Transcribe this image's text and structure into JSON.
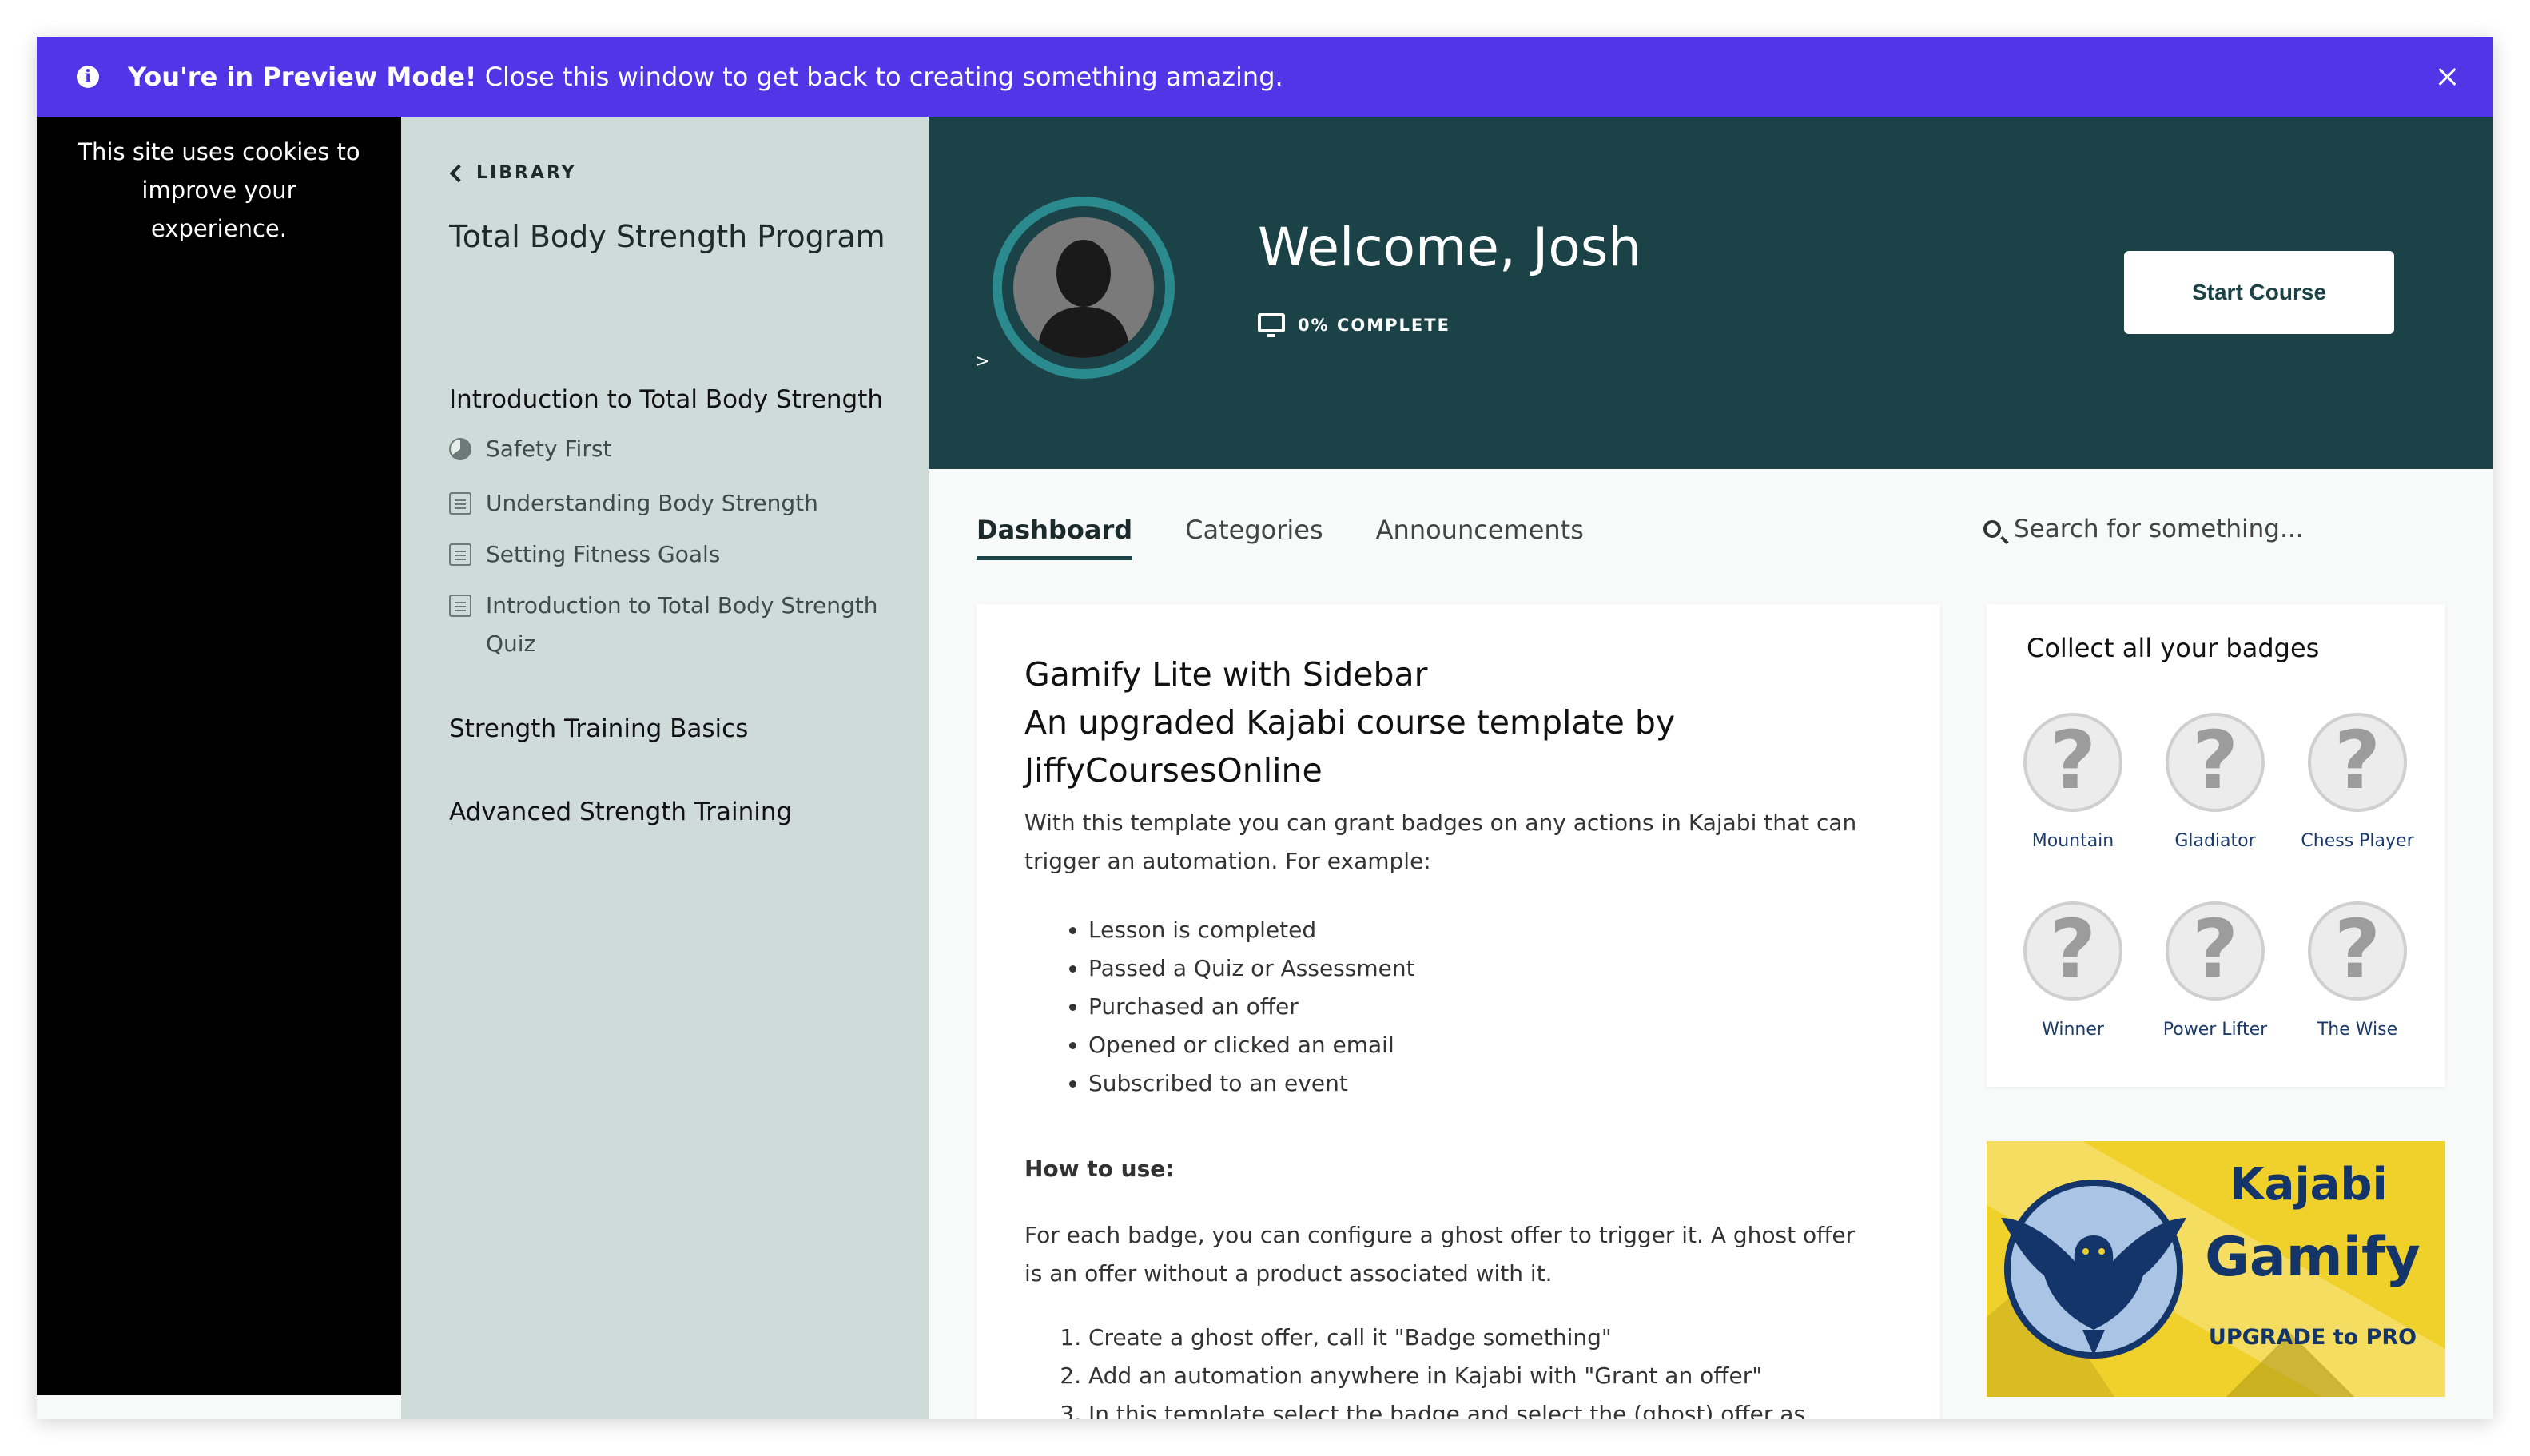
{
  "preview_banner": {
    "bold": "You're in Preview Mode!",
    "text": " Close this window to get back to creating something amazing."
  },
  "cookie_notice": "This site uses cookies to improve your experience.",
  "sidebar": {
    "library_label": "LIBRARY",
    "course_title": "Total Body Strength Program",
    "sections": [
      {
        "title": "Introduction to Total Body Strength",
        "lessons": [
          {
            "label": "Safety First",
            "icon": "progress-pie-icon"
          },
          {
            "label": "Understanding Body Strength",
            "icon": "document-icon"
          },
          {
            "label": "Setting Fitness Goals",
            "icon": "document-icon"
          },
          {
            "label": "Introduction to Total Body Strength Quiz",
            "icon": "document-icon"
          }
        ]
      },
      {
        "title": "Strength Training Basics",
        "lessons": []
      },
      {
        "title": "Advanced Strength Training",
        "lessons": []
      }
    ]
  },
  "hero": {
    "welcome": "Welcome, Josh",
    "progress_text": "0% COMPLETE",
    "arrow_text": ">",
    "start_button": "Start Course",
    "bg_color": "#1b4347",
    "ring_color": "#2a8a8d"
  },
  "tabs": [
    {
      "label": "Dashboard",
      "active": true
    },
    {
      "label": "Categories",
      "active": false
    },
    {
      "label": "Announcements",
      "active": false
    }
  ],
  "search": {
    "placeholder": "Search for something..."
  },
  "main_card": {
    "title_line1": "Gamify Lite with Sidebar",
    "title_line2": "An upgraded Kajabi course template by JiffyCoursesOnline",
    "intro": "With this template you can grant badges on any actions in Kajabi that can trigger an automation. For example:",
    "bullets": [
      "Lesson is completed",
      "Passed a Quiz or Assessment",
      "Purchased an offer",
      "Opened or clicked an email",
      "Subscribed to an event"
    ],
    "how_to_heading": "How to use:",
    "how_to_text": "For each badge, you can configure a ghost offer to trigger it. A ghost offer is an offer without a product associated with it.",
    "steps": [
      "Create a ghost offer, call it \"Badge something\"",
      "Add an automation anywhere in Kajabi with \"Grant an offer\"",
      "In this template select the badge and select the (ghost) offer as trigger."
    ]
  },
  "badges": {
    "title": "Collect all your badges",
    "items": [
      "Mountain",
      "Gladiator",
      "Chess Player",
      "Winner",
      "Power Lifter",
      "The Wise"
    ]
  },
  "promo": {
    "line1": "Kajabi",
    "line2": "Gamify",
    "line3": "UPGRADE to PRO",
    "bg_color": "#f0d02a",
    "text_color": "#14356a"
  }
}
